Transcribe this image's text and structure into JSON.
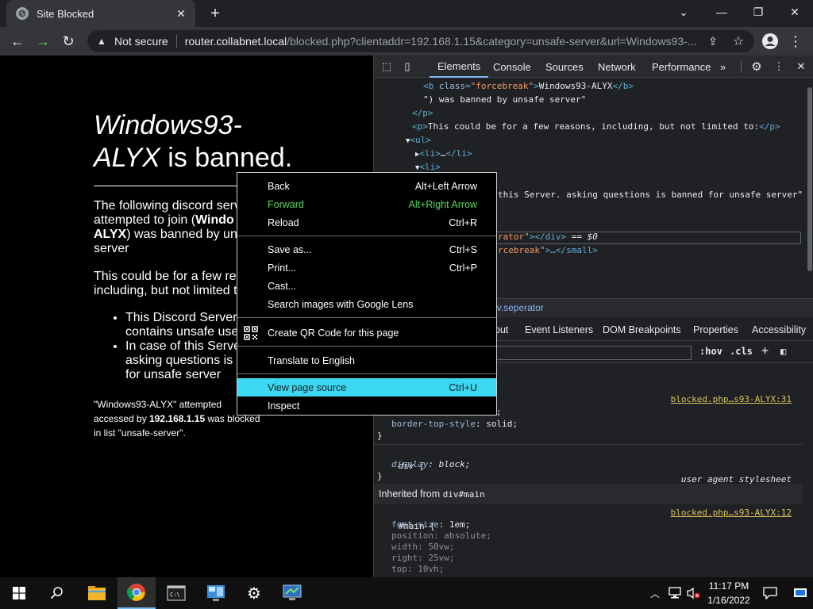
{
  "browser": {
    "tab_title": "Site Blocked",
    "address_not_secure": "Not secure",
    "address_host": "router.collabnet.local",
    "address_path": "/blocked.php?clientaddr=192.168.1.15&category=unsafe-server&url=Windows93-..."
  },
  "page": {
    "heading_italic_1": "Windows93-",
    "heading_italic_2": "ALYX",
    "heading_rest": " is banned.",
    "p1_a": "The following discord serv",
    "p1_b": "attempted to join (",
    "p1_bold_1": "Windo",
    "p1_bold_2": "ALYX",
    "p1_c": ") was banned by un",
    "p1_d": "server",
    "p2_a": "This could be for a few re",
    "p2_b": "including, but not limited t",
    "li1_a": "This Discord Server",
    "li1_b": "contains unsafe use",
    "li2_a": "In case of this Serve",
    "li2_b": "asking questions is",
    "li2_c": "for unsafe server",
    "footer_a": "\"Windows93-ALYX\" attempted",
    "footer_b_pre": "accessed by ",
    "footer_b_ip": "192.168.1.15",
    "footer_b_post": " was blocked",
    "footer_c": "in list \"unsafe-server\"."
  },
  "devtools": {
    "tabs": [
      "Elements",
      "Console",
      "Sources",
      "Network",
      "Performance"
    ],
    "overflow": "»",
    "dom": {
      "l1_open": "<b ",
      "l1_attr": "class",
      "l1_val": "\"forcebreak\"",
      "l1_close": ">",
      "l1_text": "Windows93-ALYX",
      "l1_end": "</b>",
      "l2": "\") was banned by unsafe server\"",
      "l3": "</p>",
      "l4_tag": "<p>",
      "l4_text": "This could be for a few reasons, including, but not limited to:",
      "l4_end": "</p>",
      "l5": "<ul>",
      "l6_a": "<li>",
      "l6_dots": "…",
      "l6_b": "</li>",
      "l7": "<li>",
      "l8": "this Server. asking questions is banned for unsafe server\"",
      "l9_a": "rator\"",
      "l9_b": "></div>",
      "l9_c": " == $0",
      "l10_a": "rcebreak\"",
      "l10_b": ">…</small>"
    },
    "crumb": "iv.seperator",
    "subtabs": [
      "out",
      "Event Listeners",
      "DOM Breakpoints",
      "Properties",
      "Accessibility"
    ],
    "filter_hov": ":hov",
    "filter_cls": ".cls",
    "filter_plus": "+",
    "rules": {
      "r1_partial": ";",
      "r1_prop": "border-top-style",
      "r1_val": "solid",
      "r1_link": "blocked.php…s93-ALYX:31",
      "r2_sel": "div {",
      "r2_source": "user agent stylesheet",
      "r2_prop": "display",
      "r2_val": "block",
      "inherited_label": "Inherited from ",
      "inherited_sel": "div#main",
      "r3_sel": "#main {",
      "r3_link": "blocked.php…s93-ALYX:12",
      "r3_props": [
        {
          "p": "font-size",
          "v": "1em"
        },
        {
          "p": "position",
          "v": "absolute"
        },
        {
          "p": "width",
          "v": "50vw"
        },
        {
          "p": "right",
          "v": "25vw"
        },
        {
          "p": "top",
          "v": "10vh"
        }
      ]
    }
  },
  "context_menu": {
    "items": [
      {
        "label": "Back",
        "shortcut": "Alt+Left Arrow"
      },
      {
        "label": "Forward",
        "shortcut": "Alt+Right Arrow"
      },
      {
        "label": "Reload",
        "shortcut": "Ctrl+R"
      },
      {
        "label": "Save as...",
        "shortcut": "Ctrl+S"
      },
      {
        "label": "Print...",
        "shortcut": "Ctrl+P"
      },
      {
        "label": "Cast...",
        "shortcut": ""
      },
      {
        "label": "Search images with Google Lens",
        "shortcut": ""
      },
      {
        "label": "Create QR Code for this page",
        "shortcut": ""
      },
      {
        "label": "Translate to English",
        "shortcut": ""
      },
      {
        "label": "View page source",
        "shortcut": "Ctrl+U"
      },
      {
        "label": "Inspect",
        "shortcut": ""
      }
    ]
  },
  "taskbar": {
    "time": "11:17 PM",
    "date": "1/16/2022"
  },
  "colors": {
    "forward_green": "#5bd95b",
    "highlight_cyan": "#3ad8f3",
    "devtools_link": "#dbc35d"
  },
  "icons": [
    "shield-icon",
    "close-icon",
    "plus-icon",
    "minimize-icon",
    "restore-icon",
    "back-arrow-icon",
    "forward-arrow-icon",
    "reload-icon",
    "warning-icon",
    "share-icon",
    "star-icon",
    "profile-icon",
    "menu-dots-icon",
    "inspect-icon",
    "device-toolbar-icon",
    "gear-icon",
    "qr-code-icon",
    "windows-start-icon",
    "search-icon",
    "file-explorer-icon",
    "chrome-icon",
    "terminal-icon",
    "control-panel-icon",
    "settings-icon",
    "remote-desktop-icon",
    "chevron-up-icon",
    "network-icon",
    "volume-muted-icon",
    "notification-icon"
  ]
}
